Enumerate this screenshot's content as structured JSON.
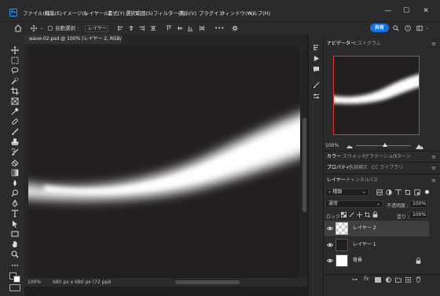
{
  "app": {
    "logo": "Ps"
  },
  "menu": [
    "ファイル(F)",
    "編集(E)",
    "イメージ(I)",
    "レイヤー(L)",
    "書式(Y)",
    "選択範囲(S)",
    "フィルター(T)",
    "表示(V)",
    "プラグイン",
    "ウィンドウ(W)",
    "ヘルプ(H)"
  ],
  "window_controls": {
    "minimize": "—",
    "maximize": "☐",
    "close": "✕"
  },
  "options": {
    "auto_select_label": "自動選択 :",
    "auto_select_value": "レイヤー",
    "more": "•••",
    "share_label": "共有"
  },
  "document": {
    "tab_title": "wave-02.psd @ 100% (レイヤー 2, RGB/8#) *",
    "close_icon": "✕"
  },
  "status": {
    "zoom": "100%",
    "info": "680 px x 680 px (72 ppi)",
    "arrow": "›"
  },
  "panels": {
    "navigator_tabs": [
      "ナビゲーター",
      "ヒストグラム"
    ],
    "navigator_zoom": "100%",
    "color_tabs": [
      "カラー",
      "スウォッチ",
      "グラデーション",
      "パターン"
    ],
    "props_tabs": [
      "プロパティ",
      "色調補正",
      "CC ライブラリ"
    ],
    "layer_tabs": [
      "レイヤー",
      "チャンネル",
      "パス"
    ],
    "kind_filter": "種類",
    "blend_mode": "通常",
    "opacity_label": "不透明度 :",
    "opacity_value": "100%",
    "lock_label": "ロック :",
    "fill_label": "塗り :",
    "fill_value": "100%",
    "layers": [
      {
        "name": "レイヤー 2",
        "selected": true
      },
      {
        "name": "レイヤー 1",
        "selected": false
      },
      {
        "name": "背景",
        "selected": false,
        "locked": true
      }
    ]
  },
  "colors": {
    "accent": "#1473e6",
    "canvas_bg": "#231f20",
    "nav_frame": "#e7322f"
  }
}
